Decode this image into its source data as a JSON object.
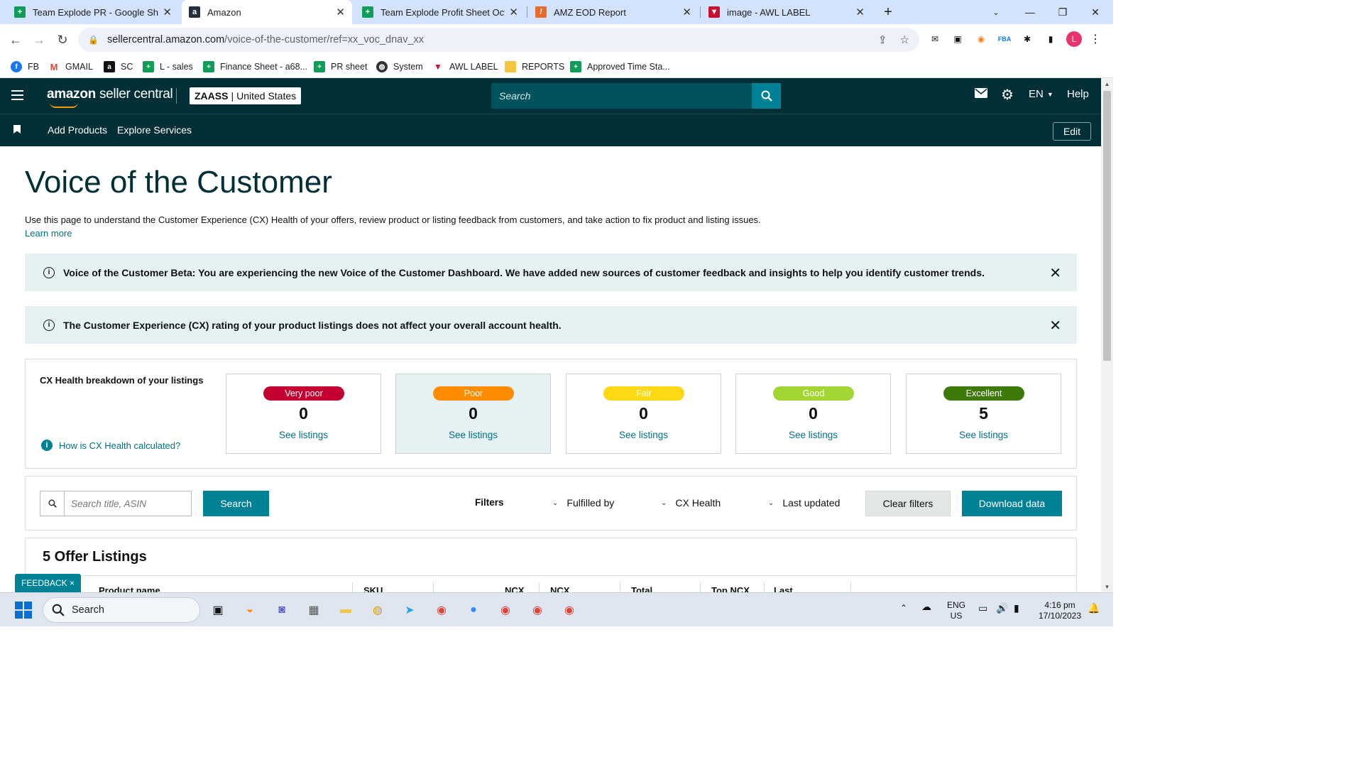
{
  "browser": {
    "tabs": [
      {
        "label": "Team Explode PR - Google Shee",
        "icon": "google-sheets-icon",
        "color": "#0f9d58"
      },
      {
        "label": "Amazon",
        "icon": "amazon-icon",
        "color": "#232f3e"
      },
      {
        "label": "Team Explode Profit Sheet Octo",
        "icon": "google-sheets-icon",
        "color": "#0f9d58"
      },
      {
        "label": "AMZ EOD Report",
        "icon": "report-icon",
        "color": "#ea6a2c"
      },
      {
        "label": "image - AWL LABEL",
        "icon": "awl-label-icon",
        "color": "#c8102e"
      }
    ],
    "url_host": "sellercentral.amazon.com",
    "url_path": "/voice-of-the-customer/ref=xx_voc_dnav_xx",
    "profile_initial": "L",
    "bookmarks": [
      {
        "label": "FB",
        "icon": "facebook-icon"
      },
      {
        "label": "GMAIL",
        "icon": "gmail-icon"
      },
      {
        "label": "SC",
        "icon": "amazon-icon"
      },
      {
        "label": "L - sales",
        "icon": "google-sheets-icon"
      },
      {
        "label": "Finance Sheet - a68...",
        "icon": "google-sheets-icon"
      },
      {
        "label": "PR sheet",
        "icon": "google-sheets-icon"
      },
      {
        "label": "System",
        "icon": "globe-icon"
      },
      {
        "label": "AWL LABEL",
        "icon": "awl-label-icon"
      },
      {
        "label": "REPORTS",
        "icon": "folder-icon"
      },
      {
        "label": "Approved Time Sta...",
        "icon": "google-sheets-icon"
      }
    ]
  },
  "header": {
    "logo_text_bold": "amazon",
    "logo_text": "seller central",
    "account_name": "ZAASS",
    "account_region": "United States",
    "search_placeholder": "Search",
    "language": "EN",
    "help": "Help",
    "nav": [
      "Add Products",
      "Explore Services"
    ],
    "edit": "Edit"
  },
  "page": {
    "title": "Voice of the Customer",
    "description": "Use this page to understand the Customer Experience (CX) Health of your offers, review product or listing feedback from customers, and take action to fix product and listing issues.",
    "learn_more": "Learn more",
    "alerts": [
      "Voice of the Customer Beta: You are experiencing the new Voice of the Customer Dashboard. We have added new sources of customer feedback and insights to help you identify customer trends.",
      "The Customer Experience (CX) rating of your product listings does not affect your overall account health."
    ]
  },
  "cx_health": {
    "title": "CX Health breakdown of your listings",
    "help_link": "How is CX Health calculated?",
    "categories": [
      {
        "label": "Very poor",
        "count": "0",
        "link": "See listings",
        "color": "#c40031",
        "text_color": "#ffffff",
        "selected": false
      },
      {
        "label": "Poor",
        "count": "0",
        "link": "See listings",
        "color": "#ff8c00",
        "text_color": "#ffffff",
        "selected": true
      },
      {
        "label": "Fair",
        "count": "0",
        "link": "See listings",
        "color": "#ffd814",
        "text_color": "#ffffff",
        "selected": false
      },
      {
        "label": "Good",
        "count": "0",
        "link": "See listings",
        "color": "#a4d633",
        "text_color": "#ffffff",
        "selected": false
      },
      {
        "label": "Excellent",
        "count": "5",
        "link": "See listings",
        "color": "#3d7a0a",
        "text_color": "#ffffff",
        "selected": false
      }
    ]
  },
  "filters": {
    "search_placeholder": "Search title, ASIN",
    "search_button": "Search",
    "filters_label": "Filters",
    "dropdowns": [
      "Fulfilled by",
      "CX Health",
      "Last updated"
    ],
    "clear": "Clear filters",
    "download": "Download data"
  },
  "listings": {
    "title": "5 Offer Listings",
    "columns": [
      "Product name",
      "SKU",
      "NCX",
      "NCX",
      "Total",
      "Top NCX",
      "Last"
    ]
  },
  "feedback": "FEEDBACK ×",
  "taskbar": {
    "search": "Search",
    "lang1": "ENG",
    "lang2": "US",
    "time": "4:16 pm",
    "date": "17/10/2023"
  },
  "colors": {
    "brand_dark": "#002f36",
    "teal": "#008296",
    "link": "#007185"
  }
}
